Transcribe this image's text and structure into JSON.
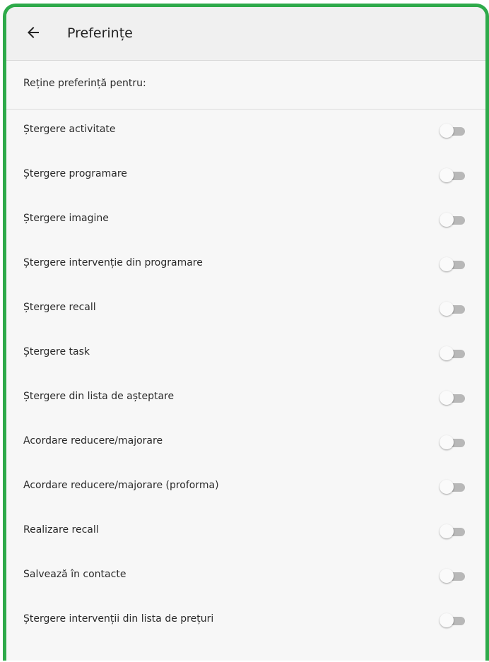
{
  "header": {
    "title": "Preferințe"
  },
  "subheader": {
    "text": "Reține preferință pentru:"
  },
  "items": [
    {
      "label": "Ștergere activitate",
      "enabled": false
    },
    {
      "label": "Ștergere programare",
      "enabled": false
    },
    {
      "label": "Ștergere imagine",
      "enabled": false
    },
    {
      "label": "Ștergere intervenție din programare",
      "enabled": false
    },
    {
      "label": "Ștergere recall",
      "enabled": false
    },
    {
      "label": "Ștergere task",
      "enabled": false
    },
    {
      "label": "Ștergere din lista de așteptare",
      "enabled": false
    },
    {
      "label": "Acordare reducere/majorare",
      "enabled": false
    },
    {
      "label": "Acordare reducere/majorare (proforma)",
      "enabled": false
    },
    {
      "label": "Realizare recall",
      "enabled": false
    },
    {
      "label": "Salvează în contacte",
      "enabled": false
    },
    {
      "label": "Ștergere intervenții din lista de prețuri",
      "enabled": false
    }
  ],
  "colors": {
    "frame_border": "#2eaa4a",
    "toggle_off_track": "#b8b8b8",
    "toggle_off_thumb": "#fafafa"
  },
  "icons": {
    "back": "arrow-left-icon"
  }
}
